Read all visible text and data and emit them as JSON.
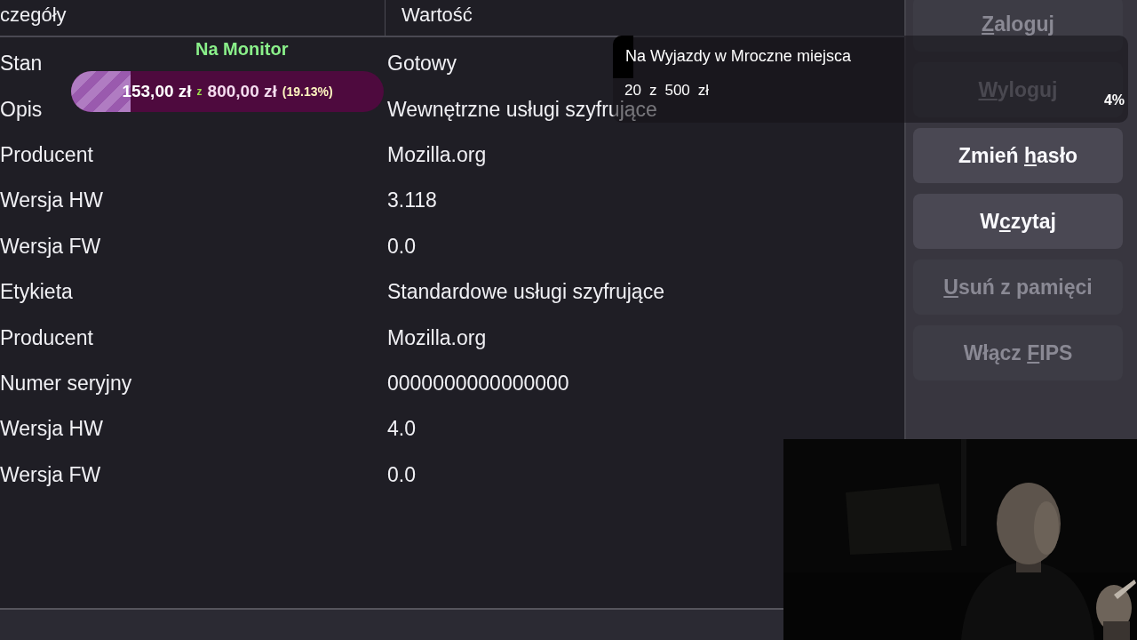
{
  "table": {
    "columns": [
      "czegóły",
      "Wartość"
    ],
    "rows": [
      {
        "name": "Stan",
        "value": "Gotowy"
      },
      {
        "name": "Opis",
        "value": "Wewnętrzne usługi szyfrujące"
      },
      {
        "name": "Producent",
        "value": "Mozilla.org"
      },
      {
        "name": "Wersja HW",
        "value": "3.118"
      },
      {
        "name": "Wersja FW",
        "value": "0.0"
      },
      {
        "name": "Etykieta",
        "value": "Standardowe usługi szyfrujące"
      },
      {
        "name": "Producent",
        "value": "Mozilla.org"
      },
      {
        "name": "Numer seryjny",
        "value": "0000000000000000"
      },
      {
        "name": "Wersja HW",
        "value": "4.0"
      },
      {
        "name": "Wersja FW",
        "value": "0.0"
      }
    ]
  },
  "buttons": [
    {
      "key": "Z",
      "after": "aloguj",
      "disabled": true
    },
    {
      "key": "W",
      "after": "yloguj",
      "disabled": true
    },
    {
      "before": "Zmień ",
      "key": "h",
      "after": "asło",
      "disabled": false
    },
    {
      "before": "W",
      "key": "c",
      "after": "zytaj",
      "disabled": false
    },
    {
      "key": "U",
      "after": "suń z pamięci",
      "disabled": true
    },
    {
      "before": "Włącz ",
      "key": "F",
      "after": "IPS",
      "disabled": true
    }
  ],
  "goal_bar": {
    "title": "Na Monitor",
    "current": "153,00 zł",
    "separator": "z",
    "target": "800,00 zł",
    "percent": "(19.13%)",
    "level": 0.1913
  },
  "goal_card": {
    "title": "Na Wyjazdy w Mroczne miejsca",
    "amount": "20",
    "separator": "z",
    "target": "500",
    "currency": "zł",
    "percent": "4%",
    "level": 0.04
  }
}
